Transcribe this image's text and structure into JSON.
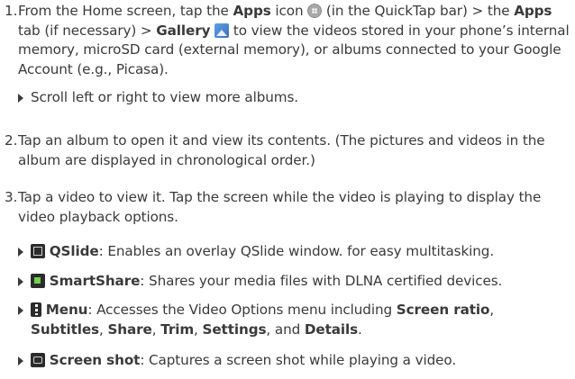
{
  "steps": [
    {
      "number": "1.",
      "parts": [
        "From the Home screen, tap the ",
        "Apps",
        " icon ",
        " (in the QuickTap bar) > the ",
        "Apps",
        " tab (if necessary) > ",
        "Gallery",
        " ",
        " to view the videos stored in your phone’s internal memory, microSD card (external memory), or albums connected to your Google Account (e.g., Picasa)."
      ],
      "bullet": "Scroll left or right to view more albums."
    },
    {
      "number": "2.",
      "text": "Tap an album to open it and view its contents. (The pictures and videos in the album are displayed in chronological order.)"
    },
    {
      "number": "3.",
      "text": "Tap a video to view it. Tap the screen while the video is playing to display the video playback options."
    }
  ],
  "options": [
    {
      "icon": "qslide-icon",
      "label": "QSlide",
      "desc": ": Enables an overlay QSlide window. for easy multitasking."
    },
    {
      "icon": "smartshare-icon",
      "label": "SmartShare",
      "desc": ": Shares your media files with DLNA certified devices."
    },
    {
      "icon": "menu-icon",
      "label": "Menu",
      "desc_parts": [
        ": Accesses the Video Options menu including ",
        "Screen ratio",
        ", ",
        "Subtitles",
        ", ",
        "Share",
        ", ",
        "Trim",
        ", ",
        "Settings",
        ", and ",
        "Details",
        "."
      ]
    },
    {
      "icon": "screenshot-icon",
      "label": "Screen shot",
      "desc": ": Captures a screen shot while playing a video."
    }
  ]
}
